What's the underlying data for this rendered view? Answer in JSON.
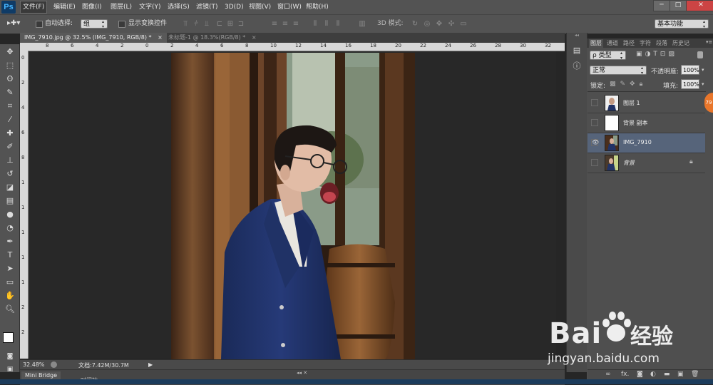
{
  "app": {
    "logo": "Ps"
  },
  "menubar": {
    "items": [
      "文件(F)",
      "编辑(E)",
      "图像(I)",
      "图层(L)",
      "文字(Y)",
      "选择(S)",
      "滤镜(T)",
      "3D(D)",
      "视图(V)",
      "窗口(W)",
      "帮助(H)"
    ],
    "active_index": 0,
    "window_buttons": [
      "─",
      "□",
      "✕"
    ]
  },
  "options": {
    "auto_select_label": "自动选择:",
    "auto_select_value": "组",
    "show_transform_label": "显示变换控件",
    "mode_3d_label": "3D 模式:",
    "workspace": "基本功能"
  },
  "tabs": [
    {
      "label": "IMG_7910.jpg @ 32.5% (IMG_7910, RGB/8) *",
      "active": true
    },
    {
      "label": "未标题-1 @ 18.3%(RGB/8) *",
      "active": false
    }
  ],
  "ruler": {
    "top_labels": [
      "8",
      "6",
      "4",
      "2",
      "0",
      "2",
      "4",
      "6",
      "8",
      "10",
      "12",
      "14",
      "16",
      "18",
      "20",
      "22",
      "24",
      "26",
      "28",
      "30",
      "32"
    ],
    "left_labels": [
      "0",
      "2",
      "4",
      "6",
      "8",
      "1",
      "1",
      "1",
      "1",
      "1",
      "2",
      "2"
    ]
  },
  "status": {
    "zoom": "32.48%",
    "doc": "文档:7.42M/30.7M"
  },
  "bottom_panel": {
    "mini_bridge": "Mini Bridge",
    "timeline": "时间轴"
  },
  "layers_panel": {
    "tabs": [
      "图层",
      "通道",
      "路径",
      "字符",
      "段落",
      "历史记"
    ],
    "filter_label": "ρ 类型",
    "blend_mode": "正常",
    "opacity_label": "不透明度:",
    "opacity_value": "100%",
    "lock_label": "锁定:",
    "fill_label": "填充:",
    "fill_value": "100%",
    "layers": [
      {
        "name": "图层 1",
        "visible": false,
        "selected": false,
        "italic": false,
        "locked": false
      },
      {
        "name": "背景 副本",
        "visible": false,
        "selected": false,
        "italic": false,
        "locked": false
      },
      {
        "name": "IMG_7910",
        "visible": true,
        "selected": true,
        "italic": false,
        "locked": false
      },
      {
        "name": "背景",
        "visible": false,
        "selected": false,
        "italic": true,
        "locked": true
      }
    ],
    "footer_icons": [
      "link-icon",
      "fx-icon",
      "mask-icon",
      "adjustment-icon",
      "folder-icon",
      "new-layer-icon",
      "trash-icon"
    ],
    "badge": "79"
  },
  "watermark": {
    "brand": "Bai",
    "brand2": "经验",
    "url": "jingyan.baidu.com"
  },
  "colors": {
    "ui_bg": "#535353",
    "panel_bg": "#4f4f4f",
    "selected_layer": "#56647a",
    "canvas_bg": "#282828"
  }
}
